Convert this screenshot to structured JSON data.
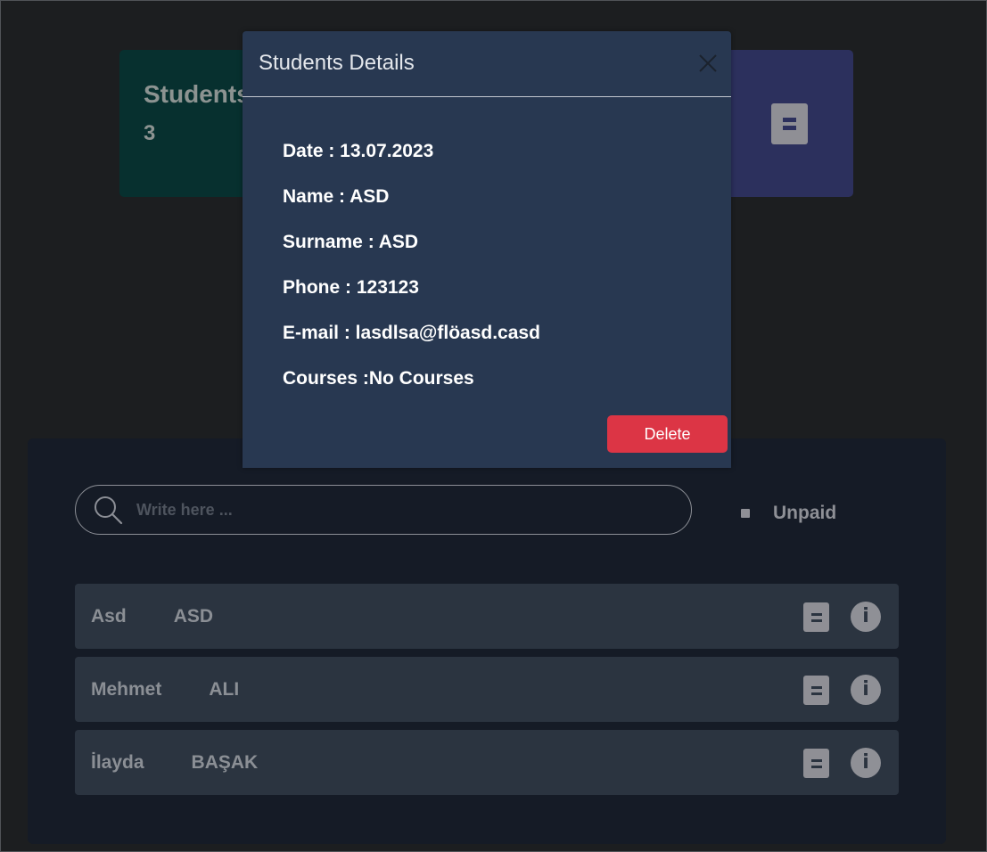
{
  "cards": {
    "students": {
      "title": "Students",
      "value": "3"
    }
  },
  "search": {
    "placeholder": "Write here ...",
    "value": ""
  },
  "filter": {
    "unpaid_label": "Unpaid"
  },
  "students": [
    {
      "name": "Asd",
      "surname": "ASD"
    },
    {
      "name": "Mehmet",
      "surname": "ALI"
    },
    {
      "name": "İlayda",
      "surname": "BAŞAK"
    }
  ],
  "modal": {
    "title": "Students Details",
    "details": [
      "Date : 13.07.2023",
      "Name : ASD",
      "Surname : ASD",
      "Phone : 123123",
      "E-mail : lasdlsa@flöasd.casd",
      "Courses :No Courses"
    ],
    "delete_label": "Delete"
  },
  "colors": {
    "page_bg": "#1c1e20",
    "students_card": "#07302f",
    "payments_card": "#2c305d",
    "panel_bg": "#151b26",
    "row_bg": "#2b3440",
    "modal_bg": "#283851",
    "delete_button": "#dc3545"
  },
  "icons": {
    "search": "search-icon",
    "close": "close-icon",
    "document": "document-icon",
    "info": "info-icon"
  }
}
